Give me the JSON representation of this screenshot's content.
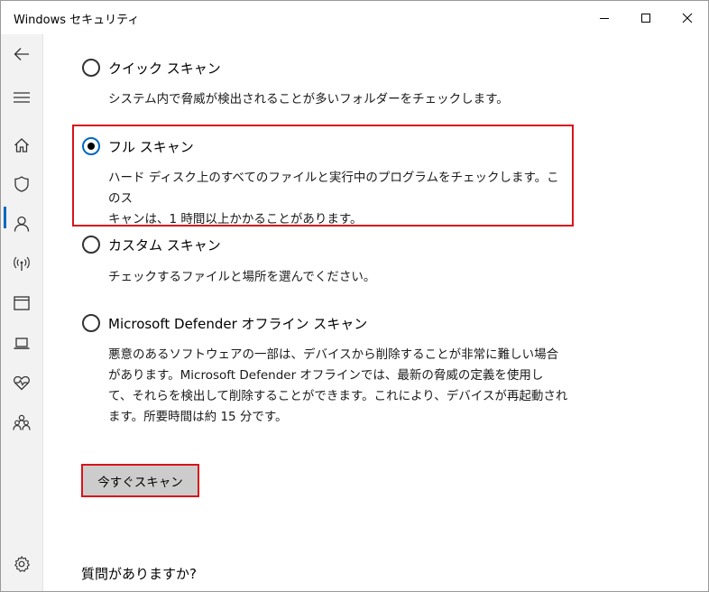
{
  "window": {
    "title": "Windows セキュリティ"
  },
  "sidebar": {
    "items": [
      {
        "name": "back-arrow-icon"
      },
      {
        "name": "hamburger-menu-icon"
      },
      {
        "name": "home-icon"
      },
      {
        "name": "shield-icon",
        "active": true
      },
      {
        "name": "person-icon"
      },
      {
        "name": "wireless-antenna-icon"
      },
      {
        "name": "app-browser-window-icon"
      },
      {
        "name": "laptop-icon"
      },
      {
        "name": "heart-pulse-icon"
      },
      {
        "name": "family-group-icon"
      },
      {
        "name": "gear-icon"
      }
    ]
  },
  "scan_options": [
    {
      "title": "クイック スキャン",
      "description": "システム内で脅威が検出されることが多いフォルダーをチェックします。",
      "selected": false
    },
    {
      "title": "フル スキャン",
      "description_lines": [
        "ハード ディスク上のすべてのファイルと実行中のプログラムをチェックします。このス",
        "キャンは、1 時間以上かかることがあります。"
      ],
      "selected": true
    },
    {
      "title": "カスタム スキャン",
      "description": "チェックするファイルと場所を選んでください。",
      "selected": false
    },
    {
      "title": "Microsoft Defender オフライン スキャン",
      "description_lines": [
        "悪意のあるソフトウェアの一部は、デバイスから削除することが非常に難しい場合",
        "があります。Microsoft Defender オフラインでは、最新の脅威の定義を使用し",
        "て、それらを検出して削除することができます。これにより、デバイスが再起動され",
        "ます。所要時間は約 15 分です。"
      ],
      "selected": false
    }
  ],
  "scan_now_button": "今すぐスキャン",
  "help_heading": "質問がありますか?",
  "colors": {
    "accent": "#0067c0",
    "highlight": "#d7141a",
    "button_bg": "#cccccc"
  }
}
